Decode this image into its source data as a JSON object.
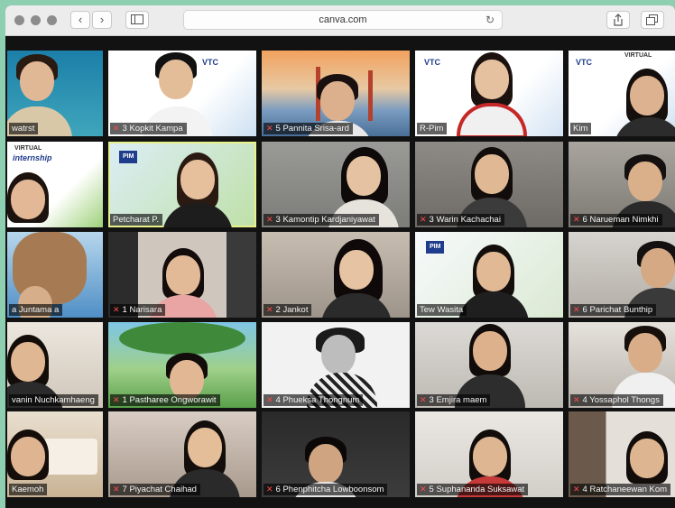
{
  "browser": {
    "url": "canva.com"
  },
  "logo_texts": {
    "pim": "PIM",
    "vtc": "VTC",
    "virtual": "VIRTUAL",
    "internship": "internship"
  },
  "participants": [
    {
      "name": "watrst",
      "muted": false
    },
    {
      "name": "3 Kopkit Kampa",
      "muted": true
    },
    {
      "name": "5 Pannita Srisa-ard",
      "muted": true
    },
    {
      "name": "R-Pim",
      "muted": false
    },
    {
      "name": "Kim",
      "muted": false
    },
    {
      "name": "",
      "muted": false
    },
    {
      "name": "Petcharat P.",
      "muted": false
    },
    {
      "name": "3 Kamontip Kardjaniyawat",
      "muted": true
    },
    {
      "name": "3 Warin Kachachai",
      "muted": true
    },
    {
      "name": "6 Narueman Nimkhi",
      "muted": true
    },
    {
      "name": "a Juntama a",
      "muted": false
    },
    {
      "name": "1 Narisara",
      "muted": true
    },
    {
      "name": "2 Jankot",
      "muted": true
    },
    {
      "name": "Tew Wasita",
      "muted": true
    },
    {
      "name": "6 Parichat Bunthip",
      "muted": true
    },
    {
      "name": "vanin Nuchkamhaeng",
      "muted": false
    },
    {
      "name": "1 Pastharee Ongworawit",
      "muted": true
    },
    {
      "name": "4 Phueksa Thongnum",
      "muted": true
    },
    {
      "name": "3 Emjira maem",
      "muted": true
    },
    {
      "name": "4 Yossaphol Thongs",
      "muted": true
    },
    {
      "name": "Kaemoh",
      "muted": false
    },
    {
      "name": "7 Piyachat Chaihad",
      "muted": true
    },
    {
      "name": "6 Phenphitcha Lowboonsom",
      "muted": true
    },
    {
      "name": "5 Suphananda Suksawat",
      "muted": true
    },
    {
      "name": "4 Ratchaneewan Kom",
      "muted": true
    }
  ]
}
